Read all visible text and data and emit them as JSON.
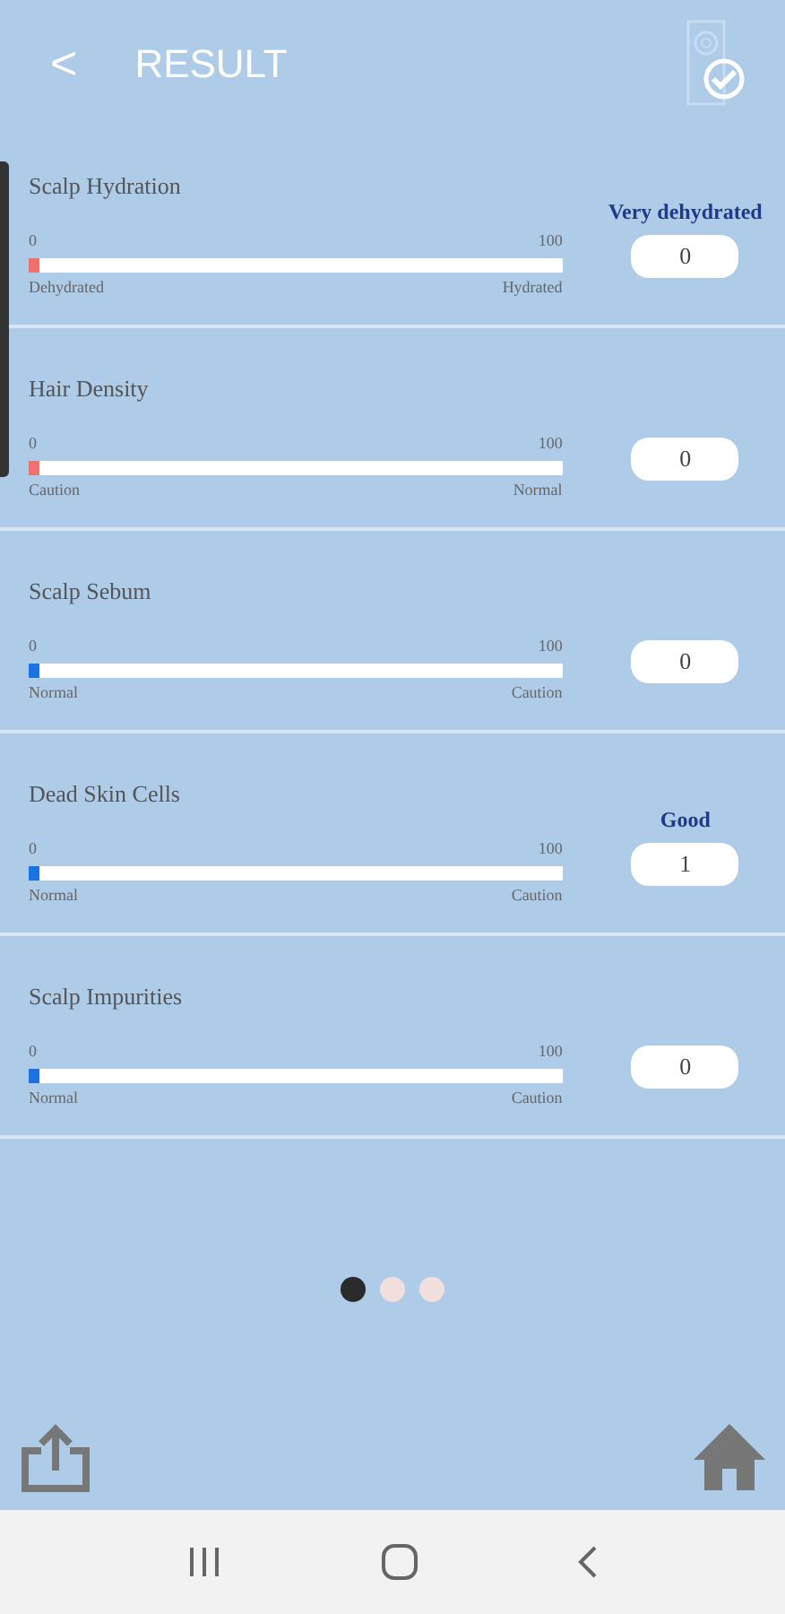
{
  "header": {
    "back": "<",
    "title": "RESULT"
  },
  "metrics": [
    {
      "name": "Scalp Hydration",
      "min": "0",
      "max": "100",
      "low_label": "Dehydrated",
      "high_label": "Hydrated",
      "level": 0.02,
      "color": "#f07070",
      "status": "Very dehydrated",
      "value": "0"
    },
    {
      "name": "Hair Density",
      "min": "0",
      "max": "100",
      "low_label": "Caution",
      "high_label": "Normal",
      "level": 0.02,
      "color": "#f07070",
      "value": "0"
    },
    {
      "name": "Scalp Sebum",
      "min": "0",
      "max": "100",
      "low_label": "Normal",
      "high_label": "Caution",
      "level": 0.02,
      "color": "#1a73e0",
      "value": "0"
    },
    {
      "name": "Dead Skin Cells",
      "min": "0",
      "max": "100",
      "low_label": "Normal",
      "high_label": "Caution",
      "level": 0.02,
      "color": "#1a73e0",
      "status": "Good",
      "value": "1"
    },
    {
      "name": "Scalp Impurities",
      "min": "0",
      "max": "100",
      "low_label": "Normal",
      "high_label": "Caution",
      "level": 0.02,
      "color": "#1a73e0",
      "value": "0"
    }
  ],
  "pages": [
    {
      "selected": true
    },
    {
      "selected": false
    },
    {
      "selected": false
    }
  ]
}
